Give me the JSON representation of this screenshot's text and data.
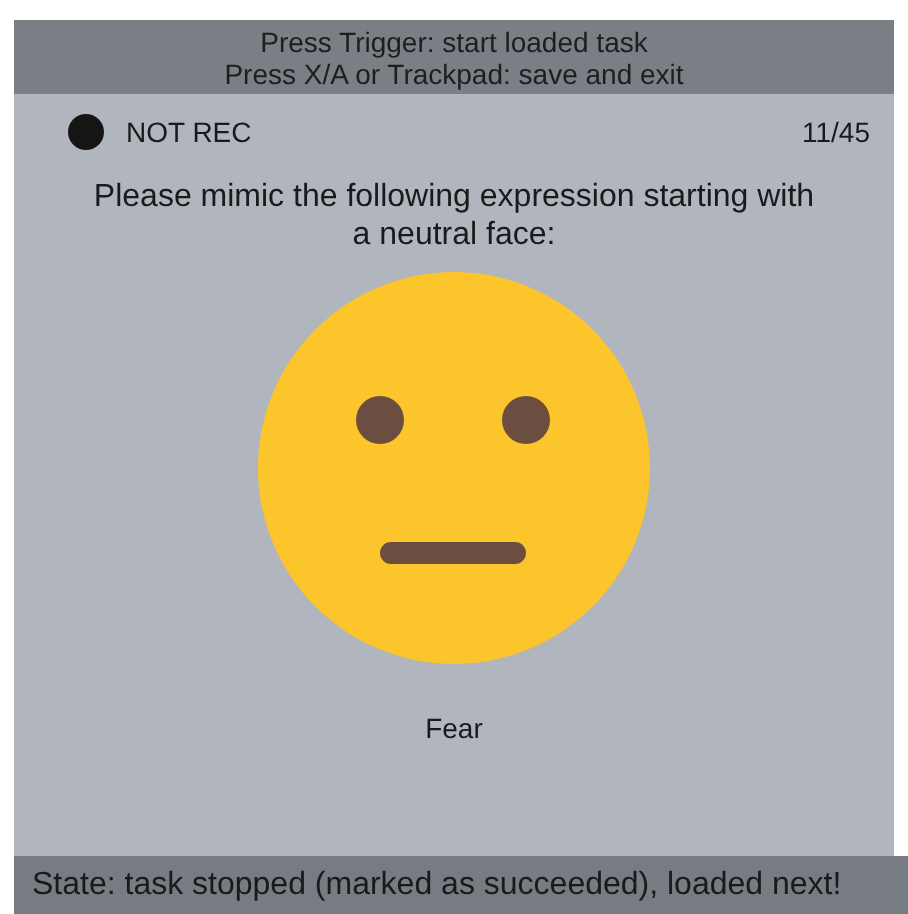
{
  "instructions": [
    "Press Trigger: start loaded task",
    "Press X/A or Trackpad: save and exit"
  ],
  "recording": {
    "on": false,
    "label": "NOT REC"
  },
  "progress": "11/45",
  "prompt": "Please mimic the following expression starting with a neutral face:",
  "expression": "Fear",
  "status": "State: task stopped (marked as succeeded), loaded next!"
}
